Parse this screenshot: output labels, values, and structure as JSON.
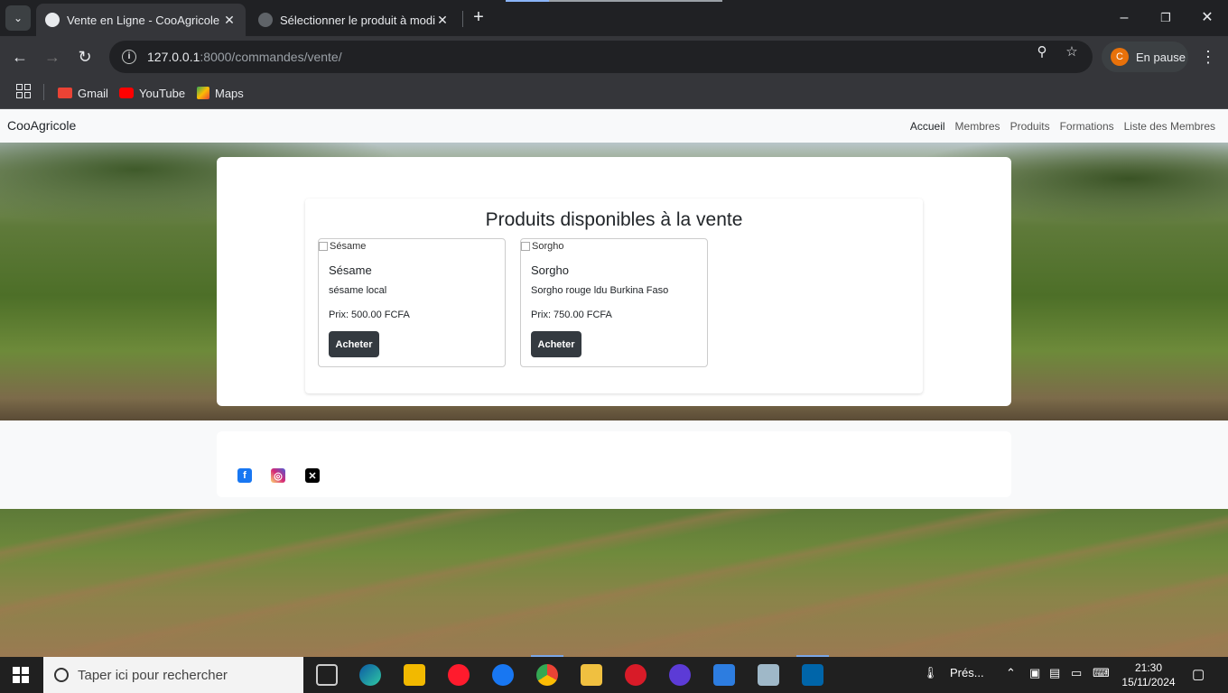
{
  "browser": {
    "tabs": [
      {
        "title": "Vente en Ligne - CooAgricole",
        "active": true
      },
      {
        "title": "Sélectionner le produit à modifier",
        "active": false
      }
    ],
    "url_host": "127.0.0.1",
    "url_path": ":8000/commandes/vente/",
    "profile_initial": "C",
    "profile_status": "En pause",
    "bookmarks": [
      "Gmail",
      "YouTube",
      "Maps"
    ]
  },
  "site": {
    "brand": "CooAgricole",
    "nav": [
      "Accueil",
      "Membres",
      "Produits",
      "Formations",
      "Liste des Membres"
    ],
    "title": "Produits disponibles à la vente",
    "products": [
      {
        "alt": "Sésame",
        "name": "Sésame",
        "description": "sésame local",
        "price": "Prix: 500.00 FCFA",
        "button": "Acheter"
      },
      {
        "alt": "Sorgho",
        "name": "Sorgho",
        "description": "Sorgho rouge ldu Burkina Faso",
        "price": "Prix: 750.00 FCFA",
        "button": "Acheter"
      }
    ],
    "social": [
      "facebook-icon",
      "instagram-icon",
      "x-icon"
    ]
  },
  "taskbar": {
    "search_placeholder": "Taper ici pour rechercher",
    "weather": "Prés...",
    "time": "21:30",
    "date": "15/11/2024"
  },
  "colors": {
    "chrome_dark": "#202124",
    "toolbar": "#35363a",
    "button_dark": "#343a40",
    "profile_avatar": "#e8710a"
  }
}
